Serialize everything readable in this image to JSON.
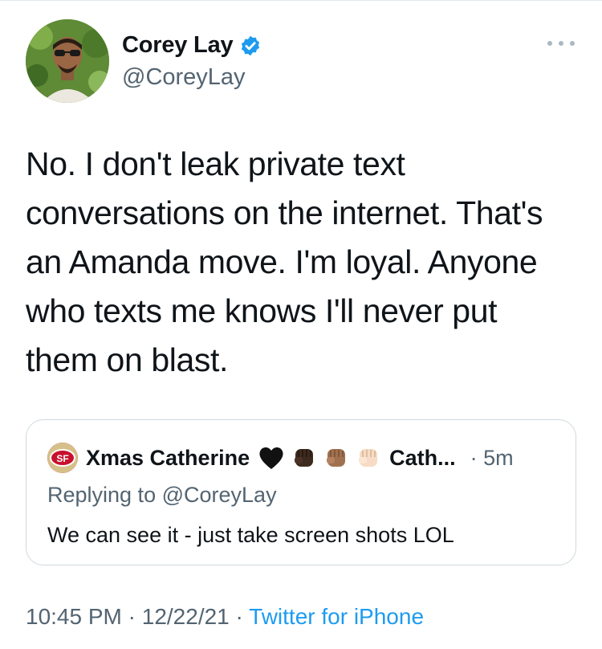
{
  "author": {
    "name": "Corey Lay",
    "handle": "@CoreyLay",
    "verified": true
  },
  "tweet": {
    "text": "No. I don't leak private text\nconversations on the internet. That's\nan Amanda move. I'm loyal. Anyone\nwho texts me knows I'll never put\nthem on blast."
  },
  "quote": {
    "name": "Xmas Catherine",
    "name_suffix": "Cath...",
    "separator": "·",
    "time": "5m",
    "emojis": [
      "black-heart-icon",
      "raised-fist-dark-icon",
      "raised-fist-medium-icon",
      "raised-fist-light-icon"
    ],
    "reply_prefix": "Replying to",
    "reply_handle": "@CoreyLay",
    "body": "We can see it - just take screen shots LOL"
  },
  "meta": {
    "time": "10:45 PM",
    "sep1": "·",
    "date": "12/22/21",
    "sep2": "·",
    "source": "Twitter for iPhone"
  },
  "colors": {
    "accent": "#1d9bf0",
    "secondary_text": "#536471",
    "border": "#cfd9de"
  }
}
